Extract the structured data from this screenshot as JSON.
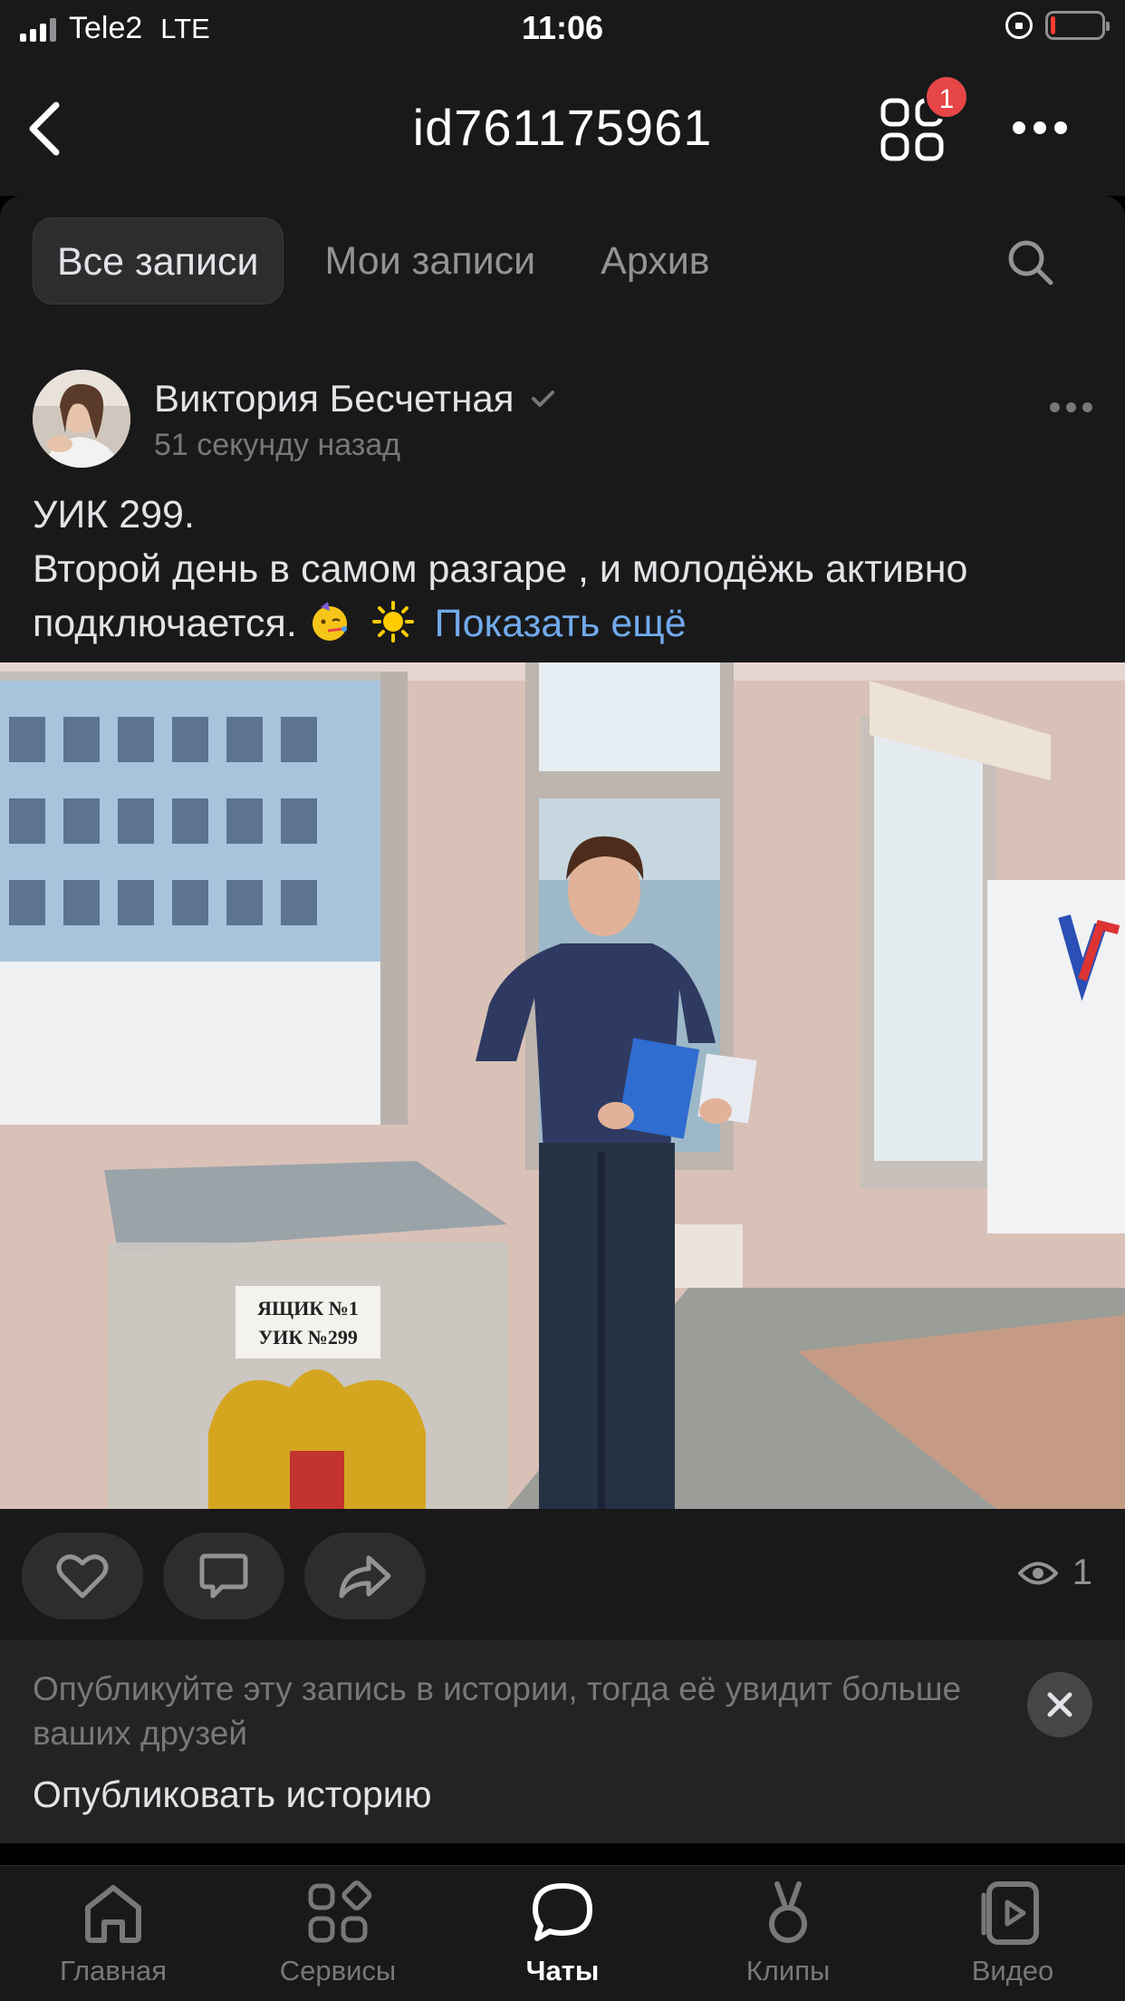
{
  "status_bar": {
    "carrier": "Tele2",
    "network": "LTE",
    "time": "11:06"
  },
  "header": {
    "title": "id761175961",
    "notification_count": "1"
  },
  "tabs": [
    {
      "label": "Все записи",
      "active": true
    },
    {
      "label": "Мои записи",
      "active": false
    },
    {
      "label": "Архив",
      "active": false
    }
  ],
  "post": {
    "author": "Виктория Бесчетная",
    "time": "51 секунду назад",
    "text_line1": "УИК 299.",
    "text_line2": "Второй день в самом разгаре , и молодёжь активно",
    "text_line3": "подключается.",
    "show_more": "Показать ещё",
    "photo_labels": {
      "box_label_1": "ЯЩИК №1",
      "box_label_2": "УИК №299"
    },
    "views": "1"
  },
  "promo": {
    "text": "Опубликуйте эту запись в истории, тогда её увидит больше ваших друзей",
    "action": "Опубликовать историю"
  },
  "tabbar": [
    {
      "label": "Главная",
      "icon": "home-icon"
    },
    {
      "label": "Сервисы",
      "icon": "services-icon"
    },
    {
      "label": "Чаты",
      "icon": "chat-icon",
      "active": true
    },
    {
      "label": "Клипы",
      "icon": "clips-icon"
    },
    {
      "label": "Видео",
      "icon": "video-icon"
    }
  ],
  "colors": {
    "background": "#19191a",
    "accent_link": "#71aaeb",
    "badge": "#e64646"
  }
}
